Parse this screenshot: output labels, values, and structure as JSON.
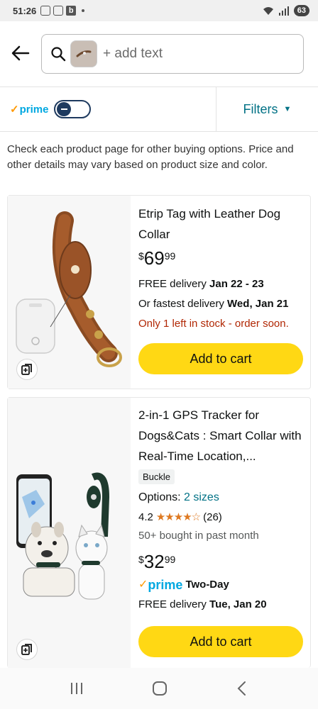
{
  "status_bar": {
    "time": "51:26",
    "battery": "63"
  },
  "search": {
    "placeholder": "+ add text"
  },
  "filter_row": {
    "prime_label": "prime",
    "filters_label": "Filters"
  },
  "disclaimer": "Check each product page for other buying options. Price and other details may vary based on product size and color.",
  "products": [
    {
      "title": "Etrip Tag with Leather Dog Collar",
      "price_currency": "$",
      "price_whole": "69",
      "price_fraction": "99",
      "delivery_prefix": "FREE delivery ",
      "delivery_date": "Jan 22 - 23",
      "fastest_prefix": "Or fastest delivery ",
      "fastest_date": "Wed, Jan 21",
      "stock": "Only 1 left in stock - order soon.",
      "cart_label": "Add to cart"
    },
    {
      "title": "2-in-1 GPS Tracker for Dogs&Cats : Smart Collar with Real-Time Location,...",
      "badge": "Buckle",
      "options_prefix": "Options: ",
      "options_link": "2 sizes",
      "rating": "4.2",
      "stars": "★★★★☆",
      "rating_count": "(26)",
      "bought": "50+ bought in past month",
      "price_currency": "$",
      "price_whole": "32",
      "price_fraction": "99",
      "prime_label": "prime",
      "prime_speed": "Two-Day",
      "delivery_prefix": "FREE delivery ",
      "delivery_date": "Tue, Jan 20",
      "cart_label": "Add to cart"
    }
  ],
  "colors": {
    "cart_button": "#ffd814",
    "link": "#007185",
    "prime_blue": "#00a8e1",
    "stock_red": "#b12704",
    "star": "#de7921"
  }
}
